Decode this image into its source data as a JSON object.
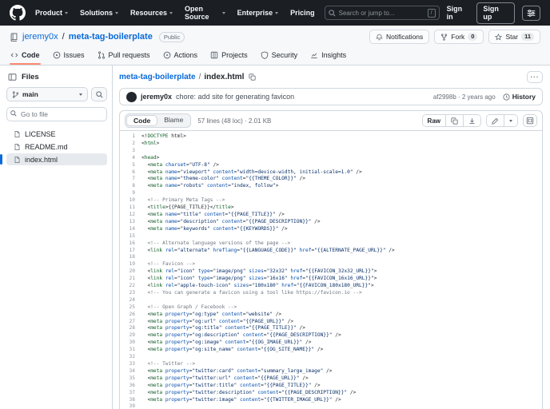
{
  "header": {
    "nav": [
      {
        "label": "Product",
        "caret": true
      },
      {
        "label": "Solutions",
        "caret": true
      },
      {
        "label": "Resources",
        "caret": true
      },
      {
        "label": "Open Source",
        "caret": true
      },
      {
        "label": "Enterprise",
        "caret": true
      },
      {
        "label": "Pricing",
        "caret": false
      }
    ],
    "search_placeholder": "Search or jump to...",
    "slash_key": "/",
    "sign_in": "Sign in",
    "sign_up": "Sign up"
  },
  "repo": {
    "owner": "jeremy0x",
    "separator": "/",
    "name": "meta-tag-boilerplate",
    "visibility": "Public",
    "notifications_label": "Notifications",
    "fork_label": "Fork",
    "fork_count": "0",
    "star_label": "Star",
    "star_count": "11"
  },
  "tabs": [
    {
      "label": "Code",
      "icon": "code",
      "active": true
    },
    {
      "label": "Issues",
      "icon": "issue",
      "active": false
    },
    {
      "label": "Pull requests",
      "icon": "pr",
      "active": false
    },
    {
      "label": "Actions",
      "icon": "actions",
      "active": false
    },
    {
      "label": "Projects",
      "icon": "projects",
      "active": false
    },
    {
      "label": "Security",
      "icon": "shield",
      "active": false
    },
    {
      "label": "Insights",
      "icon": "graph",
      "active": false
    }
  ],
  "sidebar": {
    "files_title": "Files",
    "branch": "main",
    "goto_placeholder": "Go to file",
    "files": [
      {
        "name": "LICENSE",
        "active": false
      },
      {
        "name": "README.md",
        "active": false
      },
      {
        "name": "index.html",
        "active": true
      }
    ]
  },
  "main": {
    "breadcrumb": {
      "repo": "meta-tag-boilerplate",
      "separator": "/",
      "file": "index.html"
    },
    "commit": {
      "author": "jeremy0x",
      "message": "chore: add site for generating favicon",
      "meta": "af2998b · 2 years ago",
      "history_label": "History"
    },
    "file_header": {
      "code_tab": "Code",
      "blame_tab": "Blame",
      "meta": "57 lines (48 loc) · 2.01 KB",
      "raw_label": "Raw",
      "kebab": "···"
    },
    "code_lines": [
      "<!DOCTYPE html>",
      "<html>",
      "",
      "<head>",
      "  <meta charset=\"UTF-8\" />",
      "  <meta name=\"viewport\" content=\"width=device-width, initial-scale=1.0\" />",
      "  <meta name=\"theme-color\" content=\"{{THEME_COLOR}}\" />",
      "  <meta name=\"robots\" content=\"index, follow\">",
      "",
      "  <!-- Primary Meta Tags -->",
      "  <title>{{PAGE_TITLE}}</title>",
      "  <meta name=\"title\" content=\"{{PAGE_TITLE}}\" />",
      "  <meta name=\"description\" content=\"{{PAGE_DESCRIPTION}}\" />",
      "  <meta name=\"keywords\" content=\"{{KEYWORDS}}\" />",
      "",
      "  <!-- Alternate language versions of the page -->",
      "  <link rel=\"alternate\" hreflang=\"{{LANGUAGE_CODE}}\" href=\"{{ALTERNATE_PAGE_URL}}\" />",
      "",
      "  <!-- Favicon -->",
      "  <link rel=\"icon\" type=\"image/png\" sizes=\"32x32\" href=\"{{FAVICON_32x32_URL}}\">",
      "  <link rel=\"icon\" type=\"image/png\" sizes=\"16x16\" href=\"{{FAVICON_16x16_URL}}\">",
      "  <link rel=\"apple-touch-icon\" sizes=\"180x180\" href=\"{{FAVICON_180x180_URL}}\">",
      "  <!-- You can generate a favicon using a tool like https://favicon.io -->",
      "",
      "  <!-- Open Graph / Facebook -->",
      "  <meta property=\"og:type\" content=\"website\" />",
      "  <meta property=\"og:url\" content=\"{{PAGE_URL}}\" />",
      "  <meta property=\"og:title\" content=\"{{PAGE_TITLE}}\" />",
      "  <meta property=\"og:description\" content=\"{{PAGE_DESCRIPTION}}\" />",
      "  <meta property=\"og:image\" content=\"{{OG_IMAGE_URL}}\" />",
      "  <meta property=\"og:site_name\" content=\"{{OG_SITE_NAME}}\" />",
      "",
      "  <!-- Twitter -->",
      "  <meta property=\"twitter:card\" content=\"summary_large_image\" />",
      "  <meta property=\"twitter:url\" content=\"{{PAGE_URL}}\" />",
      "  <meta property=\"twitter:title\" content=\"{{PAGE_TITLE}}\" />",
      "  <meta property=\"twitter:description\" content=\"{{PAGE_DESCRIPTION}}\" />",
      "  <meta property=\"twitter:image\" content=\"{{TWITTER_IMAGE_URL}}\" />",
      ""
    ]
  }
}
